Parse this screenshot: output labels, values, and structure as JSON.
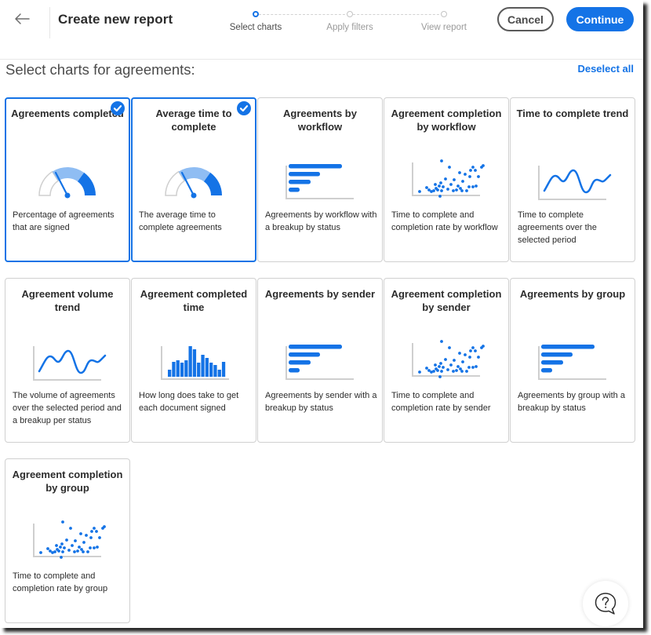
{
  "header": {
    "title": "Create new report",
    "back_icon": "arrow-left-icon",
    "steps": [
      {
        "label": "Select charts",
        "state": "active"
      },
      {
        "label": "Apply filters",
        "state": "pending"
      },
      {
        "label": "View report",
        "state": "pending"
      }
    ],
    "cancel_label": "Cancel",
    "continue_label": "Continue"
  },
  "section": {
    "title": "Select charts for agreements:",
    "deselect_label": "Deselect all"
  },
  "colors": {
    "accent": "#1473e6",
    "accent_light": "#8fbdf3",
    "axis": "#cfcfcf",
    "border": "#d0d0d0"
  },
  "cards": [
    {
      "title": "Agreements completed",
      "description": "Percentage of agreements that are signed",
      "icon": "gauge-chart-icon",
      "selected": true
    },
    {
      "title": "Average time to complete",
      "description": "The average time to complete agreements",
      "icon": "gauge-chart-icon",
      "selected": true
    },
    {
      "title": "Agreements by workflow",
      "description": "Agreements by workflow with a breakup by status",
      "icon": "horizontal-bar-chart-icon",
      "selected": false
    },
    {
      "title": "Agreement completion by workflow",
      "description": "Time to complete and completion rate by workflow",
      "icon": "scatter-chart-icon",
      "selected": false
    },
    {
      "title": "Time to complete trend",
      "description": "Time to complete agreements over the selected period",
      "icon": "line-chart-icon",
      "selected": false
    },
    {
      "title": "Agreement volume trend",
      "description": "The volume of agreements over the selected period and a breakup per status",
      "icon": "line-chart-icon",
      "selected": false
    },
    {
      "title": "Agreement completed time",
      "description": "How long does take to get each document signed",
      "icon": "histogram-chart-icon",
      "selected": false
    },
    {
      "title": "Agreements by sender",
      "description": "Agreements by sender with a breakup by status",
      "icon": "horizontal-bar-chart-icon",
      "selected": false
    },
    {
      "title": "Agreement completion by sender",
      "description": "Time to complete and completion rate by sender",
      "icon": "scatter-chart-icon",
      "selected": false
    },
    {
      "title": "Agreements by group",
      "description": "Agreements by group with a breakup by status",
      "icon": "horizontal-bar-chart-icon",
      "selected": false
    },
    {
      "title": "Agreement completion by group",
      "description": "Time to complete and completion rate by group",
      "icon": "scatter-chart-icon",
      "selected": false
    }
  ],
  "help": {
    "icon": "help-chat-icon"
  }
}
